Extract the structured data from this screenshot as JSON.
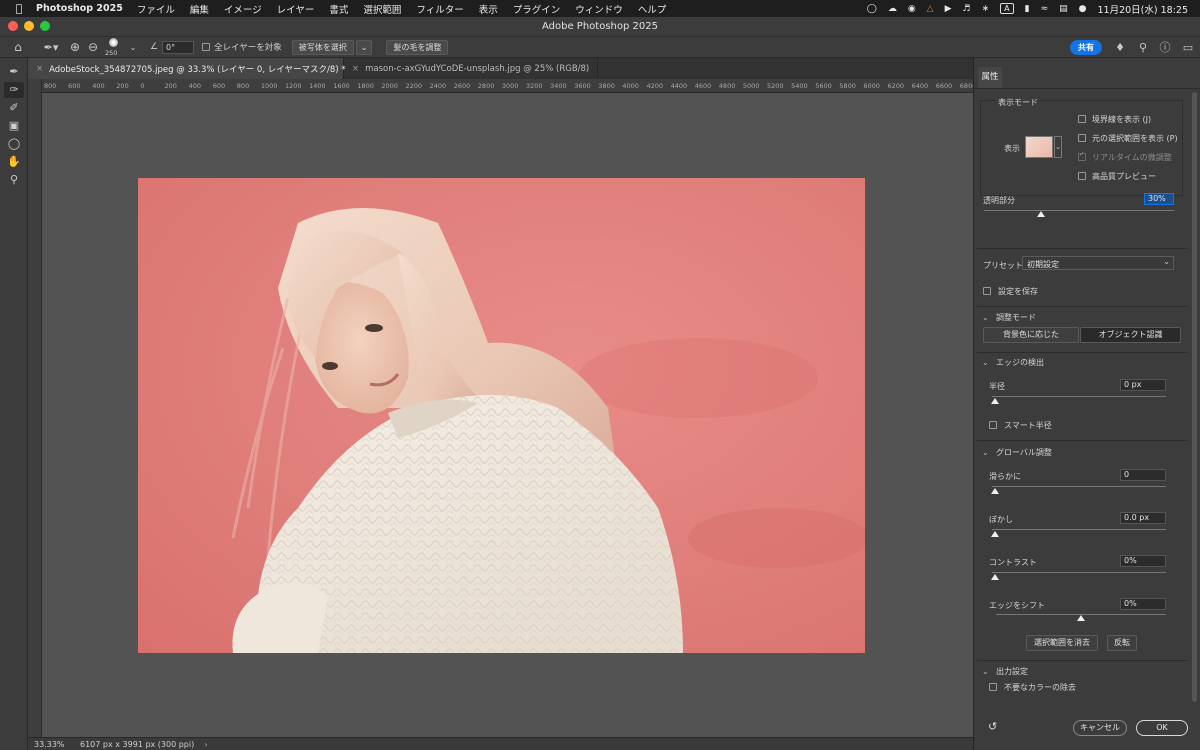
{
  "menubar": {
    "app_name": "Photoshop 2025",
    "menus": [
      "ファイル",
      "編集",
      "イメージ",
      "レイヤー",
      "書式",
      "選択範囲",
      "フィルター",
      "表示",
      "プラグイン",
      "ウィンドウ",
      "ヘルプ"
    ],
    "input_indicator": "A",
    "datetime": "11月20日(水) 18:25"
  },
  "window": {
    "title": "Adobe Photoshop 2025"
  },
  "options": {
    "brush_size": "250",
    "angle": "0°",
    "all_layers_label": "全レイヤーを対象",
    "select_subject_label": "被写体を選択",
    "refine_hair_label": "髪の毛を調整",
    "share_label": "共有"
  },
  "tabs": [
    {
      "label": "AdobeStock_354872705.jpeg @ 33.3% (レイヤー 0, レイヤーマスク/8) *"
    },
    {
      "label": "mason-c-axGYudYCoDE-unsplash.jpg @ 25% (RGB/8)"
    }
  ],
  "ruler_ticks": [
    "800",
    "600",
    "400",
    "200",
    "0",
    "200",
    "400",
    "600",
    "800",
    "1000",
    "1200",
    "1400",
    "1600",
    "1800",
    "2000",
    "2200",
    "2400",
    "2600",
    "2800",
    "3000",
    "3200",
    "3400",
    "3600",
    "3800",
    "4000",
    "4200",
    "4400",
    "4600",
    "4800",
    "5000",
    "5200",
    "5400",
    "5600",
    "5800",
    "6000",
    "6200",
    "6400",
    "6600",
    "6800"
  ],
  "status": {
    "zoom": "33.33%",
    "doc_info": "6107 px x 3991 px (300 ppi)"
  },
  "panel": {
    "tab_label": "属性",
    "view_mode": {
      "title": "表示モード",
      "view_label": "表示",
      "show_edge": "境界線を表示 (J)",
      "show_original": "元の選択範囲を表示 (P)",
      "realtime": "リアルタイムの微調整",
      "hq_preview": "高品質プレビュー"
    },
    "transparency": {
      "label": "透明部分",
      "value": "30%",
      "level": 0.3
    },
    "preset": {
      "label": "プリセット",
      "value": "初期設定"
    },
    "save_settings": "設定を保存",
    "adjust_mode": {
      "title": "調整モード",
      "color_aware": "背景色に応じた",
      "object_aware": "オブジェクト認識"
    },
    "edge_detection": {
      "title": "エッジの検出",
      "radius_label": "半径",
      "radius_value": "0 px",
      "smart_radius": "スマート半径"
    },
    "global": {
      "title": "グローバル調整",
      "smooth_label": "滑らかに",
      "smooth_value": "0",
      "feather_label": "ぼかし",
      "feather_value": "0.0 px",
      "contrast_label": "コントラスト",
      "contrast_value": "0%",
      "shift_label": "エッジをシフト",
      "shift_value": "0%",
      "clear_selection": "選択範囲を消去",
      "invert": "反転"
    },
    "output": {
      "title": "出力設定",
      "decontaminate": "不要なカラーの除去"
    },
    "cancel": "キャンセル",
    "ok": "OK"
  },
  "colors": {
    "overlay": "#e07f7b",
    "accent": "#1473e6"
  }
}
